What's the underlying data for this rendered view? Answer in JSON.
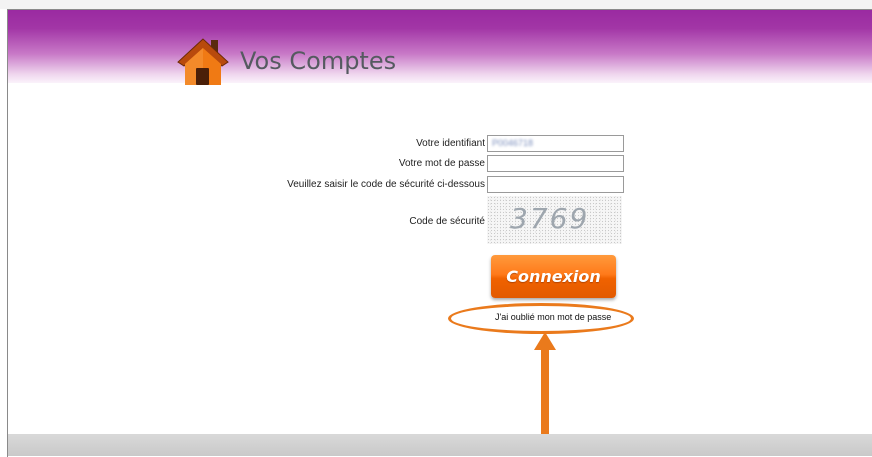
{
  "header": {
    "title": "Vos Comptes",
    "icon": "house-icon",
    "colors": {
      "bar_top": "#9a2aa1",
      "bar_bottom": "#fbf3fb",
      "house_roof": "#b84a0d",
      "house_body": "#f07a14"
    }
  },
  "login_form": {
    "identifiant_label": "Votre identifiant",
    "identifiant_value": "P0046718",
    "password_label": "Votre mot de passe",
    "password_value": "",
    "captcha_input_label": "Veuillez saisir le code de sécurité ci-dessous",
    "captcha_input_value": "",
    "captcha_label": "Code de sécurité",
    "captcha_code": "3769",
    "submit_label": "Connexion",
    "forgot_password_label": "J'ai oublié mon mot de passe"
  },
  "annotation": {
    "highlight_color": "#ea7a1c",
    "arrow_icon": "arrow-up-icon"
  }
}
